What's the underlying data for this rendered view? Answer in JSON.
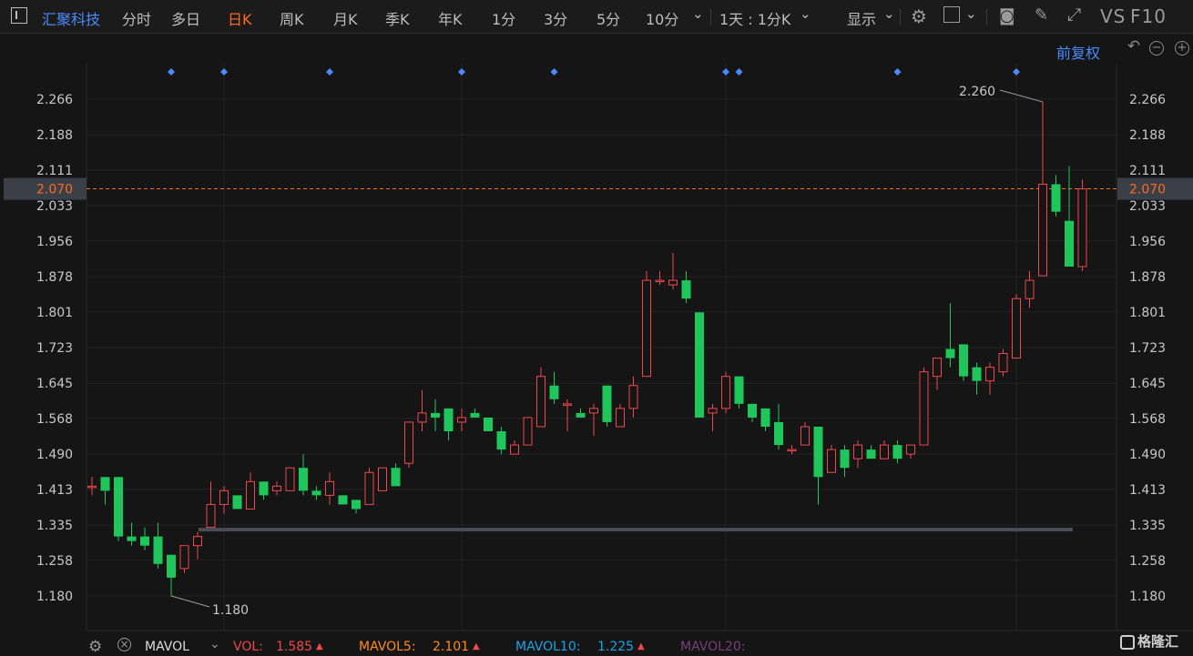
{
  "toolbar": {
    "stock_name": "汇聚科技",
    "tabs": [
      "分时",
      "多日",
      "日K",
      "周K",
      "月K",
      "季K",
      "年K",
      "1分",
      "3分",
      "5分",
      "10分"
    ],
    "active_tab": "日K",
    "period_select": "1天 : 1分K",
    "display_label": "显示",
    "vs_label": "VS",
    "f10_label": "F10"
  },
  "adjust_label": "前复权",
  "chart_data": {
    "type": "candlestick",
    "ylim": [
      1.13,
      2.33
    ],
    "y_ticks": [
      "2.266",
      "2.188",
      "2.111",
      "2.033",
      "1.956",
      "1.878",
      "1.801",
      "1.723",
      "1.645",
      "1.568",
      "1.490",
      "1.413",
      "1.335",
      "1.258",
      "1.180"
    ],
    "current_price": "2.070",
    "high_label": "2.260",
    "low_label": "1.180",
    "support_line": 1.325,
    "event_marker_indices": [
      6,
      10,
      18,
      28,
      35,
      48,
      49,
      61,
      70
    ],
    "vertical_grid_indices": [
      10,
      28,
      48,
      70
    ],
    "candles": [
      {
        "o": 1.42,
        "h": 1.44,
        "l": 1.4,
        "c": 1.42
      },
      {
        "o": 1.44,
        "h": 1.44,
        "l": 1.38,
        "c": 1.41
      },
      {
        "o": 1.44,
        "h": 1.44,
        "l": 1.3,
        "c": 1.31
      },
      {
        "o": 1.31,
        "h": 1.34,
        "l": 1.29,
        "c": 1.3
      },
      {
        "o": 1.31,
        "h": 1.33,
        "l": 1.28,
        "c": 1.29
      },
      {
        "o": 1.31,
        "h": 1.34,
        "l": 1.24,
        "c": 1.25
      },
      {
        "o": 1.27,
        "h": 1.27,
        "l": 1.18,
        "c": 1.22
      },
      {
        "o": 1.24,
        "h": 1.29,
        "l": 1.23,
        "c": 1.29
      },
      {
        "o": 1.29,
        "h": 1.32,
        "l": 1.26,
        "c": 1.31
      },
      {
        "o": 1.33,
        "h": 1.43,
        "l": 1.33,
        "c": 1.38
      },
      {
        "o": 1.38,
        "h": 1.42,
        "l": 1.36,
        "c": 1.41
      },
      {
        "o": 1.4,
        "h": 1.4,
        "l": 1.37,
        "c": 1.37
      },
      {
        "o": 1.37,
        "h": 1.45,
        "l": 1.37,
        "c": 1.43
      },
      {
        "o": 1.43,
        "h": 1.43,
        "l": 1.39,
        "c": 1.4
      },
      {
        "o": 1.41,
        "h": 1.43,
        "l": 1.4,
        "c": 1.42
      },
      {
        "o": 1.41,
        "h": 1.46,
        "l": 1.41,
        "c": 1.46
      },
      {
        "o": 1.46,
        "h": 1.49,
        "l": 1.4,
        "c": 1.41
      },
      {
        "o": 1.41,
        "h": 1.42,
        "l": 1.39,
        "c": 1.4
      },
      {
        "o": 1.4,
        "h": 1.45,
        "l": 1.38,
        "c": 1.43
      },
      {
        "o": 1.4,
        "h": 1.4,
        "l": 1.38,
        "c": 1.38
      },
      {
        "o": 1.39,
        "h": 1.39,
        "l": 1.36,
        "c": 1.37
      },
      {
        "o": 1.38,
        "h": 1.46,
        "l": 1.38,
        "c": 1.45
      },
      {
        "o": 1.41,
        "h": 1.46,
        "l": 1.41,
        "c": 1.46
      },
      {
        "o": 1.46,
        "h": 1.47,
        "l": 1.42,
        "c": 1.42
      },
      {
        "o": 1.47,
        "h": 1.56,
        "l": 1.46,
        "c": 1.56
      },
      {
        "o": 1.56,
        "h": 1.63,
        "l": 1.54,
        "c": 1.58
      },
      {
        "o": 1.58,
        "h": 1.61,
        "l": 1.54,
        "c": 1.57
      },
      {
        "o": 1.59,
        "h": 1.59,
        "l": 1.52,
        "c": 1.54
      },
      {
        "o": 1.56,
        "h": 1.59,
        "l": 1.54,
        "c": 1.57
      },
      {
        "o": 1.58,
        "h": 1.59,
        "l": 1.57,
        "c": 1.57
      },
      {
        "o": 1.57,
        "h": 1.57,
        "l": 1.54,
        "c": 1.54
      },
      {
        "o": 1.54,
        "h": 1.55,
        "l": 1.49,
        "c": 1.5
      },
      {
        "o": 1.49,
        "h": 1.52,
        "l": 1.49,
        "c": 1.51
      },
      {
        "o": 1.51,
        "h": 1.57,
        "l": 1.51,
        "c": 1.57
      },
      {
        "o": 1.55,
        "h": 1.68,
        "l": 1.55,
        "c": 1.66
      },
      {
        "o": 1.64,
        "h": 1.67,
        "l": 1.6,
        "c": 1.61
      },
      {
        "o": 1.6,
        "h": 1.61,
        "l": 1.54,
        "c": 1.6
      },
      {
        "o": 1.58,
        "h": 1.59,
        "l": 1.57,
        "c": 1.57
      },
      {
        "o": 1.58,
        "h": 1.6,
        "l": 1.53,
        "c": 1.59
      },
      {
        "o": 1.64,
        "h": 1.64,
        "l": 1.55,
        "c": 1.56
      },
      {
        "o": 1.55,
        "h": 1.6,
        "l": 1.55,
        "c": 1.59
      },
      {
        "o": 1.59,
        "h": 1.66,
        "l": 1.57,
        "c": 1.64
      },
      {
        "o": 1.66,
        "h": 1.89,
        "l": 1.66,
        "c": 1.87
      },
      {
        "o": 1.87,
        "h": 1.89,
        "l": 1.86,
        "c": 1.87
      },
      {
        "o": 1.86,
        "h": 1.93,
        "l": 1.85,
        "c": 1.87
      },
      {
        "o": 1.87,
        "h": 1.89,
        "l": 1.82,
        "c": 1.83
      },
      {
        "o": 1.8,
        "h": 1.8,
        "l": 1.57,
        "c": 1.57
      },
      {
        "o": 1.58,
        "h": 1.6,
        "l": 1.54,
        "c": 1.59
      },
      {
        "o": 1.59,
        "h": 1.67,
        "l": 1.58,
        "c": 1.66
      },
      {
        "o": 1.66,
        "h": 1.66,
        "l": 1.59,
        "c": 1.6
      },
      {
        "o": 1.6,
        "h": 1.6,
        "l": 1.56,
        "c": 1.57
      },
      {
        "o": 1.59,
        "h": 1.59,
        "l": 1.54,
        "c": 1.55
      },
      {
        "o": 1.56,
        "h": 1.6,
        "l": 1.5,
        "c": 1.51
      },
      {
        "o": 1.5,
        "h": 1.51,
        "l": 1.49,
        "c": 1.5
      },
      {
        "o": 1.51,
        "h": 1.56,
        "l": 1.51,
        "c": 1.55
      },
      {
        "o": 1.55,
        "h": 1.55,
        "l": 1.38,
        "c": 1.44
      },
      {
        "o": 1.45,
        "h": 1.51,
        "l": 1.45,
        "c": 1.5
      },
      {
        "o": 1.5,
        "h": 1.51,
        "l": 1.44,
        "c": 1.46
      },
      {
        "o": 1.48,
        "h": 1.52,
        "l": 1.46,
        "c": 1.51
      },
      {
        "o": 1.5,
        "h": 1.51,
        "l": 1.49,
        "c": 1.48
      },
      {
        "o": 1.48,
        "h": 1.52,
        "l": 1.48,
        "c": 1.51
      },
      {
        "o": 1.51,
        "h": 1.52,
        "l": 1.47,
        "c": 1.48
      },
      {
        "o": 1.49,
        "h": 1.51,
        "l": 1.48,
        "c": 1.51
      },
      {
        "o": 1.51,
        "h": 1.68,
        "l": 1.51,
        "c": 1.67
      },
      {
        "o": 1.66,
        "h": 1.7,
        "l": 1.63,
        "c": 1.7
      },
      {
        "o": 1.72,
        "h": 1.82,
        "l": 1.68,
        "c": 1.7
      },
      {
        "o": 1.73,
        "h": 1.73,
        "l": 1.65,
        "c": 1.66
      },
      {
        "o": 1.68,
        "h": 1.69,
        "l": 1.62,
        "c": 1.65
      },
      {
        "o": 1.65,
        "h": 1.69,
        "l": 1.62,
        "c": 1.68
      },
      {
        "o": 1.67,
        "h": 1.72,
        "l": 1.66,
        "c": 1.71
      },
      {
        "o": 1.7,
        "h": 1.84,
        "l": 1.7,
        "c": 1.83
      },
      {
        "o": 1.83,
        "h": 1.89,
        "l": 1.81,
        "c": 1.87
      },
      {
        "o": 1.88,
        "h": 2.26,
        "l": 1.88,
        "c": 2.08
      },
      {
        "o": 2.08,
        "h": 2.1,
        "l": 2.01,
        "c": 2.02
      },
      {
        "o": 2.0,
        "h": 2.12,
        "l": 1.9,
        "c": 1.9
      },
      {
        "o": 1.9,
        "h": 2.09,
        "l": 1.89,
        "c": 2.07
      }
    ]
  },
  "bottom": {
    "indicator": "MAVOL",
    "vol_label": "VOL:",
    "vol_value": "1.585",
    "ma5_label": "MAVOL5:",
    "ma5_value": "2.101",
    "ma10_label": "MAVOL10:",
    "ma10_value": "1.225",
    "ma20_label": "MAVOL20:",
    "up_arrow": "▲"
  },
  "brand": "格隆汇",
  "colors": {
    "up": "#f0484d",
    "down": "#1fc65c",
    "accent": "#ff6a21",
    "blue": "#4a8cff",
    "marker": "#4a8cff"
  }
}
